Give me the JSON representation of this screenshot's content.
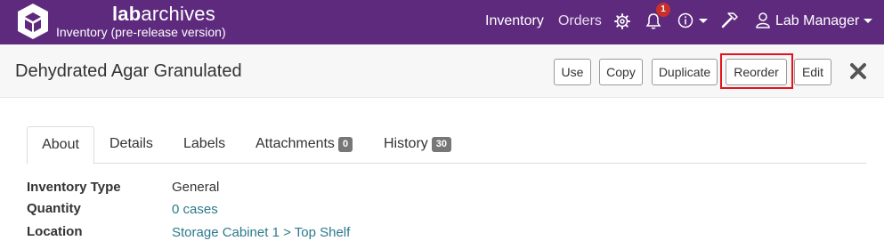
{
  "header": {
    "brand_bold": "lab",
    "brand_rest": "archives",
    "subtitle": "Inventory (pre-release version)",
    "nav": {
      "inventory": "Inventory",
      "orders": "Orders"
    },
    "notification_count": "1",
    "user": "Lab Manager",
    "colors": {
      "bar": "#5e2a7e",
      "badge": "#c9302c"
    }
  },
  "titlebar": {
    "title": "Dehydrated Agar Granulated",
    "buttons": {
      "use": "Use",
      "copy": "Copy",
      "duplicate": "Duplicate",
      "reorder": "Reorder",
      "edit": "Edit"
    },
    "highlight_color": "#e3121d"
  },
  "tabs": {
    "about": "About",
    "details": "Details",
    "labels": "Labels",
    "attachments": "Attachments",
    "attachments_count": "0",
    "history": "History",
    "history_count": "30"
  },
  "properties": {
    "type_label": "Inventory Type",
    "type_value": "General",
    "quantity_label": "Quantity",
    "quantity_value": "0 cases",
    "location_label": "Location",
    "location_value": "Storage Cabinet 1 > Top Shelf"
  }
}
